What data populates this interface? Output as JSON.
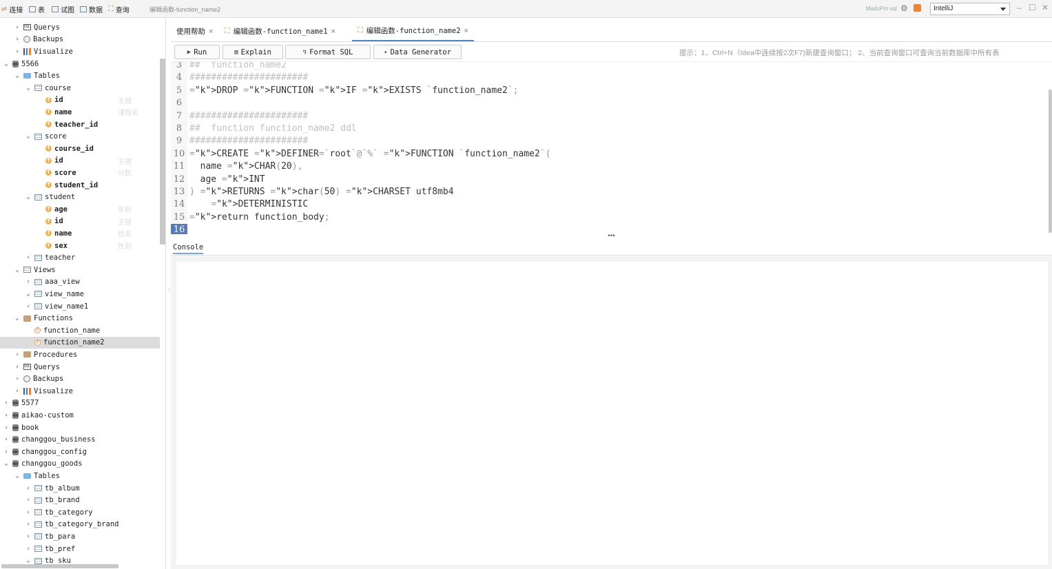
{
  "toolbar": {
    "items": [
      {
        "label": "连接",
        "icon": "connection-icon"
      },
      {
        "label": "表",
        "icon": "table-icon"
      },
      {
        "label": "试图",
        "icon": "view-icon"
      },
      {
        "label": "数据",
        "icon": "data-icon"
      },
      {
        "label": "查询",
        "icon": "query-icon"
      }
    ],
    "window_title": "编辑函数-function_name2",
    "brand": "MaduPro sql",
    "theme": "IntelliJ",
    "win_minimize": "–",
    "win_maximize": "☐",
    "win_close": "✕"
  },
  "sidebar": {
    "rows": [
      {
        "label": "Querys",
        "arrow": "›",
        "icon": "sql",
        "comment": ""
      },
      {
        "label": "Backups",
        "arrow": "›",
        "icon": "backup",
        "comment": ""
      },
      {
        "label": "Visualize",
        "arrow": "›",
        "icon": "vis",
        "comment": ""
      },
      {
        "label": "5566",
        "arrow": "⌄",
        "icon": "db",
        "comment": ""
      },
      {
        "label": "Tables",
        "arrow": "⌄",
        "icon": "folder",
        "comment": ""
      },
      {
        "label": "course",
        "arrow": "⌄",
        "icon": "table",
        "comment": ""
      },
      {
        "label": "id",
        "arrow": "",
        "icon": "field",
        "comment": "主键"
      },
      {
        "label": "name",
        "arrow": "",
        "icon": "field",
        "comment": "课程名"
      },
      {
        "label": "teacher_id",
        "arrow": "",
        "icon": "field",
        "comment": ""
      },
      {
        "label": "score",
        "arrow": "⌄",
        "icon": "table",
        "comment": ""
      },
      {
        "label": "course_id",
        "arrow": "",
        "icon": "field",
        "comment": ""
      },
      {
        "label": "id",
        "arrow": "",
        "icon": "field",
        "comment": "主键"
      },
      {
        "label": "score",
        "arrow": "",
        "icon": "field",
        "comment": "分数"
      },
      {
        "label": "student_id",
        "arrow": "",
        "icon": "field",
        "comment": ""
      },
      {
        "label": "student",
        "arrow": "⌄",
        "icon": "table",
        "comment": ""
      },
      {
        "label": "age",
        "arrow": "",
        "icon": "field",
        "comment": "年龄"
      },
      {
        "label": "id",
        "arrow": "",
        "icon": "field",
        "comment": "主键"
      },
      {
        "label": "name",
        "arrow": "",
        "icon": "field",
        "comment": "姓名"
      },
      {
        "label": "sex",
        "arrow": "",
        "icon": "field",
        "comment": "性别"
      },
      {
        "label": "teacher",
        "arrow": "›",
        "icon": "table",
        "comment": ""
      },
      {
        "label": "Views",
        "arrow": "⌄",
        "icon": "table",
        "comment": ""
      },
      {
        "label": "aaa_view",
        "arrow": "›",
        "icon": "table",
        "comment": ""
      },
      {
        "label": "view_name",
        "arrow": "⌄",
        "icon": "table",
        "comment": ""
      },
      {
        "label": "view_name1",
        "arrow": "›",
        "icon": "table",
        "comment": ""
      },
      {
        "label": "Functions",
        "arrow": "⌄",
        "icon": "funcfolder",
        "comment": ""
      },
      {
        "label": "function_name",
        "arrow": "",
        "icon": "func",
        "comment": ""
      },
      {
        "label": "function_name2",
        "arrow": "",
        "icon": "func",
        "comment": "",
        "selected": true
      },
      {
        "label": "Procedures",
        "arrow": "›",
        "icon": "procfolder",
        "comment": ""
      },
      {
        "label": "Querys",
        "arrow": "›",
        "icon": "sql",
        "comment": ""
      },
      {
        "label": "Backups",
        "arrow": "›",
        "icon": "backup",
        "comment": ""
      },
      {
        "label": "Visualize",
        "arrow": "›",
        "icon": "vis",
        "comment": ""
      },
      {
        "label": "5577",
        "arrow": "›",
        "icon": "db",
        "comment": ""
      },
      {
        "label": "aikao-custom",
        "arrow": "›",
        "icon": "db",
        "comment": ""
      },
      {
        "label": "book",
        "arrow": "›",
        "icon": "db",
        "comment": ""
      },
      {
        "label": "changgou_business",
        "arrow": "›",
        "icon": "db",
        "comment": ""
      },
      {
        "label": "changgou_config",
        "arrow": "›",
        "icon": "db",
        "comment": ""
      },
      {
        "label": "changgou_goods",
        "arrow": "⌄",
        "icon": "db",
        "comment": ""
      },
      {
        "label": "Tables",
        "arrow": "⌄",
        "icon": "folder",
        "comment": ""
      },
      {
        "label": "tb_album",
        "arrow": "›",
        "icon": "table",
        "comment": ""
      },
      {
        "label": "tb_brand",
        "arrow": "›",
        "icon": "table",
        "comment": ""
      },
      {
        "label": "tb_category",
        "arrow": "›",
        "icon": "table",
        "comment": ""
      },
      {
        "label": "tb_category_brand",
        "arrow": "›",
        "icon": "table",
        "comment": ""
      },
      {
        "label": "tb_para",
        "arrow": "›",
        "icon": "table",
        "comment": ""
      },
      {
        "label": "tb_pref",
        "arrow": "›",
        "icon": "table",
        "comment": ""
      },
      {
        "label": "tb_sku",
        "arrow": "⌄",
        "icon": "table",
        "comment": ""
      }
    ]
  },
  "tabs": [
    {
      "label": "使用帮助",
      "close": "×",
      "has_icon": false,
      "active": false
    },
    {
      "label": "编辑函数-function_name1",
      "close": "×",
      "has_icon": true,
      "active": false
    },
    {
      "label": "编辑函数-function_name2",
      "close": "×",
      "has_icon": true,
      "active": true
    }
  ],
  "editor_toolbar": {
    "run": "Run",
    "explain": "Explain",
    "format": "Format SQL",
    "generator": "Data Generator",
    "hint": "提示：1、Ctrl+N（Idea中连续按2次F7)新建查询窗口；  2、当前查询窗口可查询当前数据库中所有表"
  },
  "editor": {
    "current_line": "16",
    "lines": [
      {
        "n": "3",
        "text": "##  function_name2"
      },
      {
        "n": "4",
        "text": "######################"
      },
      {
        "n": "5",
        "text": "DROP FUNCTION IF EXISTS `function_name2`;"
      },
      {
        "n": "6",
        "text": ""
      },
      {
        "n": "7",
        "text": "######################"
      },
      {
        "n": "8",
        "text": "##  function function_name2 ddl"
      },
      {
        "n": "9",
        "text": "######################"
      },
      {
        "n": "10",
        "text": "CREATE DEFINER=`root`@`%` FUNCTION `function_name2`("
      },
      {
        "n": "11",
        "text": "  name CHAR(20),"
      },
      {
        "n": "12",
        "text": "  age INT"
      },
      {
        "n": "13",
        "text": ") RETURNS char(50) CHARSET utf8mb4"
      },
      {
        "n": "14",
        "text": "    DETERMINISTIC"
      },
      {
        "n": "15",
        "text": "return function_body;"
      },
      {
        "n": "16",
        "text": ""
      }
    ]
  },
  "console": {
    "tab": "Console",
    "splitter": "•••"
  }
}
